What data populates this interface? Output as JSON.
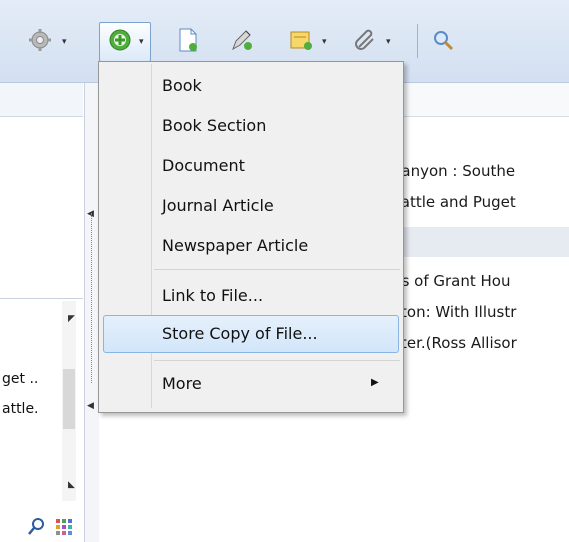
{
  "toolbar": {
    "icons": [
      "gear-icon",
      "add-item-icon",
      "new-document-icon",
      "edit-pencil-icon",
      "note-icon",
      "attachment-clip-icon",
      "search-icon"
    ]
  },
  "menu": {
    "items": [
      {
        "label": "Book"
      },
      {
        "label": "Book Section"
      },
      {
        "label": "Document"
      },
      {
        "label": "Journal Article"
      },
      {
        "label": "Newspaper Article"
      },
      {
        "label": "Link to File..."
      },
      {
        "label": "Store Copy of File..."
      },
      {
        "label": "More"
      }
    ],
    "highlighted_index": 6
  },
  "items_list": {
    "rows": [
      "l Canyon : Southe",
      "Seattle and Puget",
      "ries of Grant Hou",
      "ngton: With Illustr",
      "unter.(Ross Allisor"
    ]
  },
  "left_list": {
    "rows": [
      "get ..",
      "attle."
    ]
  },
  "colors": {
    "accent": "#8ab4e3",
    "toolbar": "#d3e0f1"
  }
}
